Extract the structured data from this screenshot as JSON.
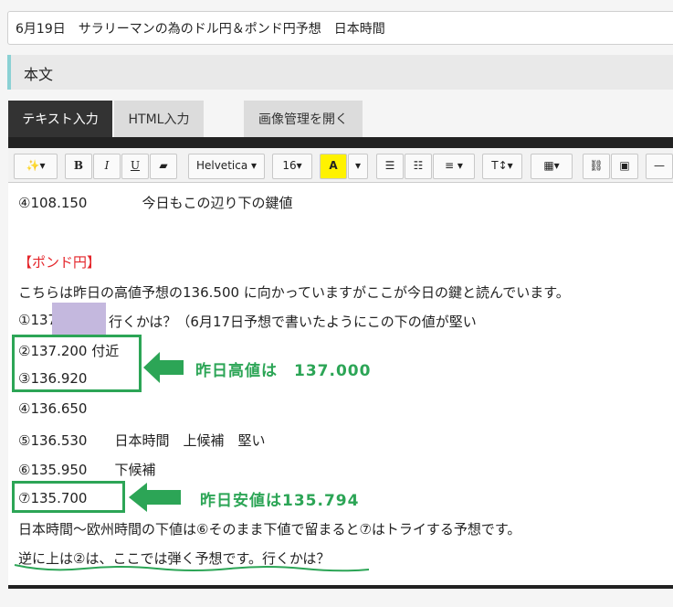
{
  "post_title": "6月19日　サラリーマンの為のドル円＆ポンド円予想　日本時間",
  "section_heading": "本文",
  "tabs": {
    "text_input": "テキスト入力",
    "html_input": "HTML入力",
    "image_manager": "画像管理を開く"
  },
  "toolbar": {
    "magic": "✨▾",
    "bold": "B",
    "italic": "I",
    "underline": "U",
    "eraser": "▰",
    "font_family": "Helvetica ▾",
    "font_size": "16▾",
    "color": "A",
    "color_caret": "▾",
    "ul": "☰",
    "ol": "☷",
    "align": "≡ ▾",
    "text_style": "T↕▾",
    "table": "▦▾",
    "link": "⛓",
    "image": "▣",
    "hr": "—"
  },
  "lines": [
    "④108.150　　　　今日もこの辺り下の鍵値",
    "【ポンド円】",
    "こちらは昨日の高値予想の136.500 に向かっていますがここが今日の鍵と読んでいます。",
    "①137",
    "行くかは？（6月17日予想で書いたようにこの下の値が堅い",
    "②137.200 付近",
    "③136.920",
    "④136.650",
    "⑤136.530　　日本時間　上候補　堅い",
    "⑥135.950　　下候補",
    "⑦135.700",
    "日本時間～欧州時間の下値は⑥そのまま下値で留まると⑦はトライする予想です。",
    "逆に上は②は、ここでは弾く予想です。行くかは？"
  ],
  "annotations": {
    "high": "昨日高値は　137.000",
    "low": "昨日安値は135.794"
  },
  "colors": {
    "green": "#2ca556",
    "red": "#e4252a",
    "accent": "#8bd1d4"
  }
}
